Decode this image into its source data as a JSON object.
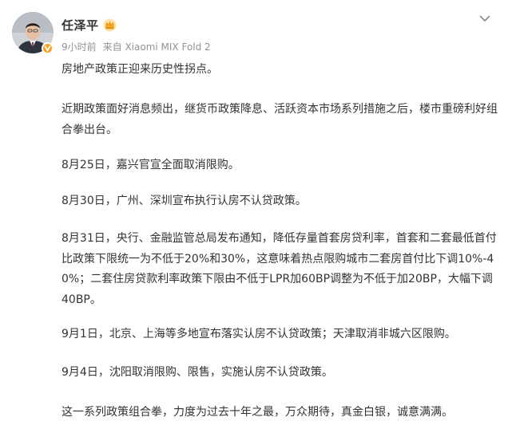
{
  "post": {
    "author": "任泽平",
    "time": "9小时前",
    "source": "来自 Xiaomi MIX Fold 2",
    "paragraphs": [
      "房地产政策正迎来历史性拐点。",
      "近期政策面好消息频出，继货币政策降息、活跃资本市场系列措施之后，楼市重磅利好组合拳出台。",
      "8月25日，嘉兴官宣全面取消限购。",
      "8月30日，广州、深圳宣布执行认房不认贷政策。",
      "8月31日，央行、金融监管总局发布通知，降低存量首套房贷利率，首套和二套最低首付比政策下限统一为不低于20%和30%，这意味着热点限购城市二套房首付比下调10%-40%；二套住房贷款利率政策下限由不低于LPR加60BP调整为不低于加20BP，大幅下调40BP。",
      "9月1日，北京、上海等多地宣布落实认房不认贷政策；天津取消非城六区限购。",
      "9月4日，沈阳取消限购、限售，实施认房不认贷政策。",
      "这一系列政策组合拳，力度为过去十年之最，万众期待，真金白银，诚意满满。"
    ]
  },
  "icons": {
    "avatar": "author-avatar",
    "verified": "verified-v-icon",
    "member": "crown-icon",
    "menu": "chevron-down-icon"
  },
  "colors": {
    "text": "#333333",
    "meta": "#939393",
    "verified_badge": "#f7a11a"
  }
}
